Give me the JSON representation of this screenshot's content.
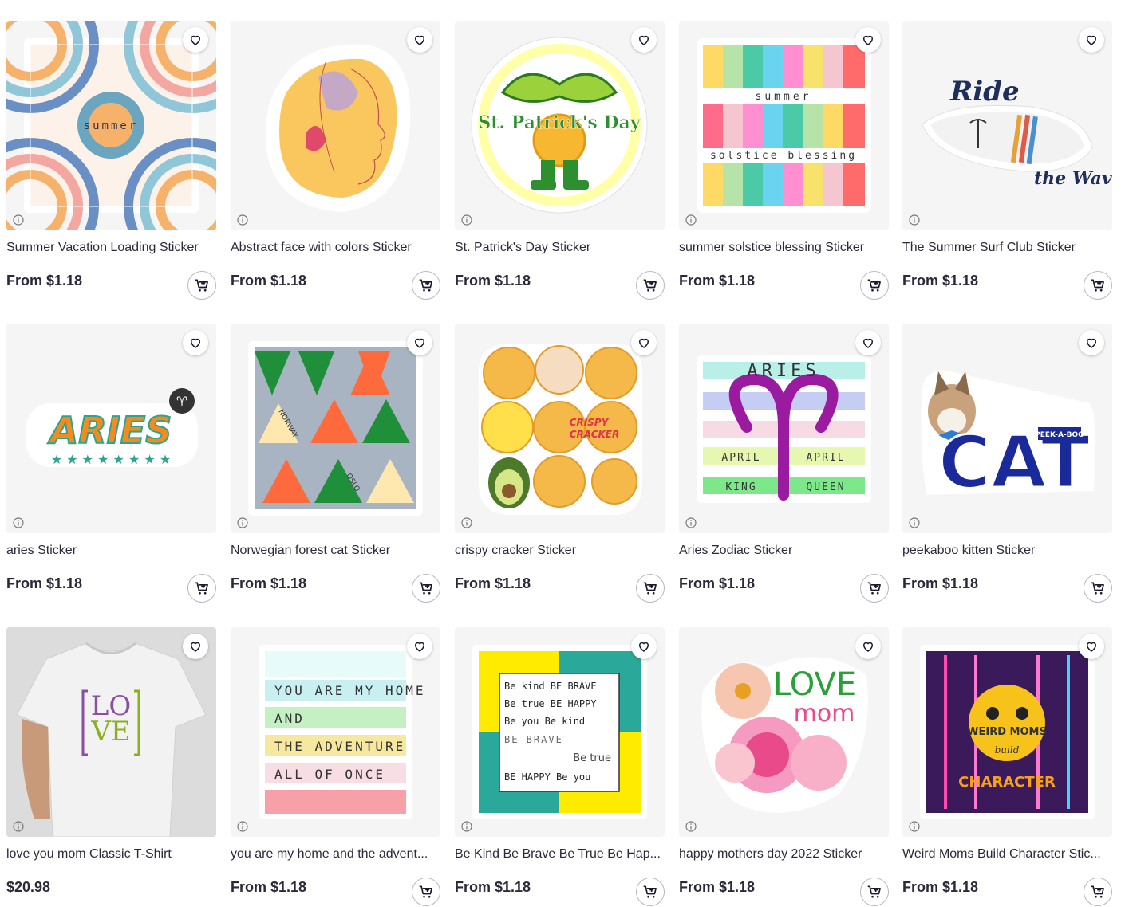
{
  "products": [
    {
      "title": "Summer Vacation Loading Sticker",
      "price": "From $1.18",
      "image_text": "summer"
    },
    {
      "title": "Abstract face with colors Sticker",
      "price": "From $1.18"
    },
    {
      "title": "St. Patrick's Day Sticker",
      "price": "From $1.18",
      "image_text": "St. Patrick's Day"
    },
    {
      "title": "summer solstice blessing Sticker",
      "price": "From $1.18",
      "image_text": "summer",
      "image_text_2": "solstice blessing"
    },
    {
      "title": "The Summer Surf Club Sticker",
      "price": "From $1.18",
      "image_text": "Ride",
      "image_text_2": "the Wave"
    },
    {
      "title": "aries Sticker",
      "price": "From $1.18",
      "image_text": "ARIES",
      "image_text_2": "♈"
    },
    {
      "title": "Norwegian forest cat Sticker",
      "price": "From $1.18",
      "image_text": "NORWAY",
      "image_text_2": "OSLO"
    },
    {
      "title": "crispy cracker Sticker",
      "price": "From $1.18",
      "image_text": "CRISPY",
      "image_text_2": "CRACKER"
    },
    {
      "title": "Aries Zodiac Sticker",
      "price": "From $1.18",
      "image_text": "ARIES",
      "labels": [
        "APRIL",
        "APRIL",
        "KING",
        "QUEEN"
      ]
    },
    {
      "title": "peekaboo kitten Sticker",
      "price": "From $1.18",
      "image_text": "CAT",
      "image_text_2": "PEEK-A-BOO"
    },
    {
      "title": "love you mom Classic T-Shirt",
      "price": "$20.98",
      "image_text": "LO",
      "image_text_2": "VE"
    },
    {
      "title": "you are my home and the advent...",
      "price": "From $1.18",
      "lines": [
        "YOU ARE MY HOME",
        "AND",
        "THE ADVENTURE",
        "ALL OF ONCE"
      ]
    },
    {
      "title": "Be Kind Be Brave Be True Be Hap...",
      "price": "From $1.18",
      "lines": [
        "Be kind  BE BRAVE",
        "Be true  BE HAPPY",
        "Be you  Be kind",
        "BE BRAVE",
        "Be true",
        "BE HAPPY Be you"
      ]
    },
    {
      "title": "happy mothers day 2022 Sticker",
      "price": "From $1.18",
      "image_text": "LOVE",
      "image_text_2": "mom"
    },
    {
      "title": "Weird Moms Build Character Stic...",
      "price": "From $1.18",
      "image_text": "WEIRD MOMS",
      "image_text_2": "build",
      "image_text_3": "CHARACTER"
    }
  ],
  "colors": {
    "text": "#2a2a3a",
    "thumb_bg": "#f5f5f5",
    "icon": "#1a1a2e"
  }
}
